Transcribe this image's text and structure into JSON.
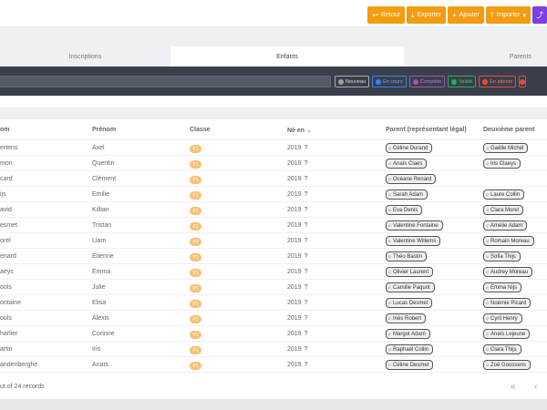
{
  "toolbar": {
    "back": "Retour",
    "export": "Exporter",
    "add": "Ajouter",
    "import": "Importer"
  },
  "tabs": [
    "Inscriptions",
    "Enfants",
    "Parents"
  ],
  "filters": [
    {
      "label": "Nouveau",
      "color": "#9e9e9e"
    },
    {
      "label": "En cours",
      "color": "#3b82f6"
    },
    {
      "label": "Complète",
      "color": "#9b59b6"
    },
    {
      "label": "Validé",
      "color": "#27ae60"
    },
    {
      "label": "En attente",
      "color": "#e74c3c"
    }
  ],
  "table": {
    "columns": [
      "om",
      "Prénom",
      "Classe",
      "Né en",
      "Parent (représentant légal)",
      "Deuxième parent"
    ],
    "rows": [
      {
        "nom": "ertens",
        "prenom": "Axel",
        "classe": "P1",
        "ne": "2019",
        "parent": "Céline Durand",
        "parent2": "Gaëlle Michel"
      },
      {
        "nom": "mon",
        "prenom": "Quentin",
        "classe": "P1",
        "ne": "2019",
        "parent": "Anaïs Claes",
        "parent2": "Iris Claeys"
      },
      {
        "nom": "card",
        "prenom": "Clément",
        "classe": "P1",
        "ne": "2019",
        "parent": "Océane Renard",
        "parent2": ""
      },
      {
        "nom": "ijs",
        "prenom": "Emilie",
        "classe": "P1",
        "ne": "2019",
        "parent": "Sarah Adam",
        "parent2": "Laure Collin"
      },
      {
        "nom": "avid",
        "prenom": "Killian",
        "classe": "P1",
        "ne": "2019",
        "parent": "Eva Denis",
        "parent2": "Clara Morel"
      },
      {
        "nom": "esmet",
        "prenom": "Tristan",
        "classe": "P1",
        "ne": "2019",
        "parent": "Valentine Fontaine",
        "parent2": "Amélie Adam"
      },
      {
        "nom": "orel",
        "prenom": "Liam",
        "classe": "P1",
        "ne": "2019",
        "parent": "Valentine Willems",
        "parent2": "Romain Moreau"
      },
      {
        "nom": "enard",
        "prenom": "Etienne",
        "classe": "P1",
        "ne": "2019",
        "parent": "Théo Bastin",
        "parent2": "Sofia Thijs"
      },
      {
        "nom": "aeys",
        "prenom": "Emma",
        "classe": "P1",
        "ne": "2019",
        "parent": "Olivier Laurent",
        "parent2": "Audrey Moreau"
      },
      {
        "nom": "ools",
        "prenom": "Julie",
        "classe": "P1",
        "ne": "2019",
        "parent": "Camille Paquot",
        "parent2": "Emma Nijs"
      },
      {
        "nom": "ontaine",
        "prenom": "Elisa",
        "classe": "P1",
        "ne": "2019",
        "parent": "Lucas Desmet",
        "parent2": "Noémie Picard"
      },
      {
        "nom": "ools",
        "prenom": "Alexis",
        "classe": "P1",
        "ne": "2019",
        "parent": "Inès Robert",
        "parent2": "Cyril Henry"
      },
      {
        "nom": "harlier",
        "prenom": "Corinne",
        "classe": "P1",
        "ne": "2019",
        "parent": "Margot Adam",
        "parent2": "Anaïs Lejeune"
      },
      {
        "nom": "artin",
        "prenom": "Iris",
        "classe": "P1",
        "ne": "2019",
        "parent": "Raphaël Collin",
        "parent2": "Clara Thijs"
      },
      {
        "nom": "andenberghe",
        "prenom": "Anaïs",
        "classe": "P1",
        "ne": "2019",
        "parent": "Céline Desmet",
        "parent2": "Zoé Goossens"
      }
    ]
  },
  "footer": {
    "info": "ut of 24 records"
  }
}
